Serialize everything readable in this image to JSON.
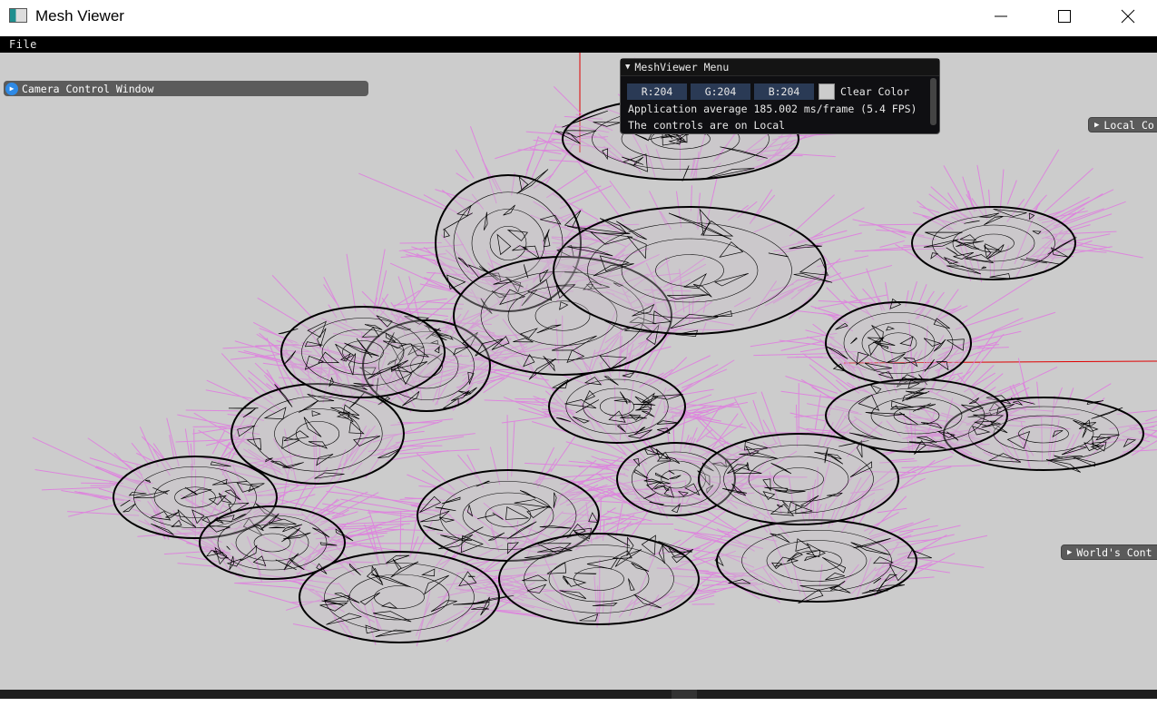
{
  "window": {
    "title": "Mesh Viewer",
    "controls": {
      "minimize_icon": "minimize-icon",
      "maximize_icon": "maximize-icon",
      "close_icon": "close-icon"
    }
  },
  "menubar": {
    "file_label": "File"
  },
  "camera_window": {
    "label": "Camera Control Window",
    "icon": "expand-arrow-icon"
  },
  "local_window": {
    "label": "Local Co"
  },
  "world_window": {
    "label": "World's Cont"
  },
  "meshviewer_menu": {
    "title": "MeshViewer Menu",
    "r_label": "R:204",
    "g_label": "G:204",
    "b_label": "B:204",
    "clear_color_label": "Clear Color",
    "fps_text": "Application average 185.002 ms/frame (5.4 FPS)",
    "controls_text": "The controls are on Local"
  },
  "colors": {
    "viewport_bg": "#cccccc",
    "normals": "#e07ae0",
    "wireframe": "#000000",
    "axis": "#e00000",
    "menubar_bg": "#000000",
    "color_channel_bg": "#2a3a55",
    "camera_window_bg": "#5b5b5b"
  }
}
